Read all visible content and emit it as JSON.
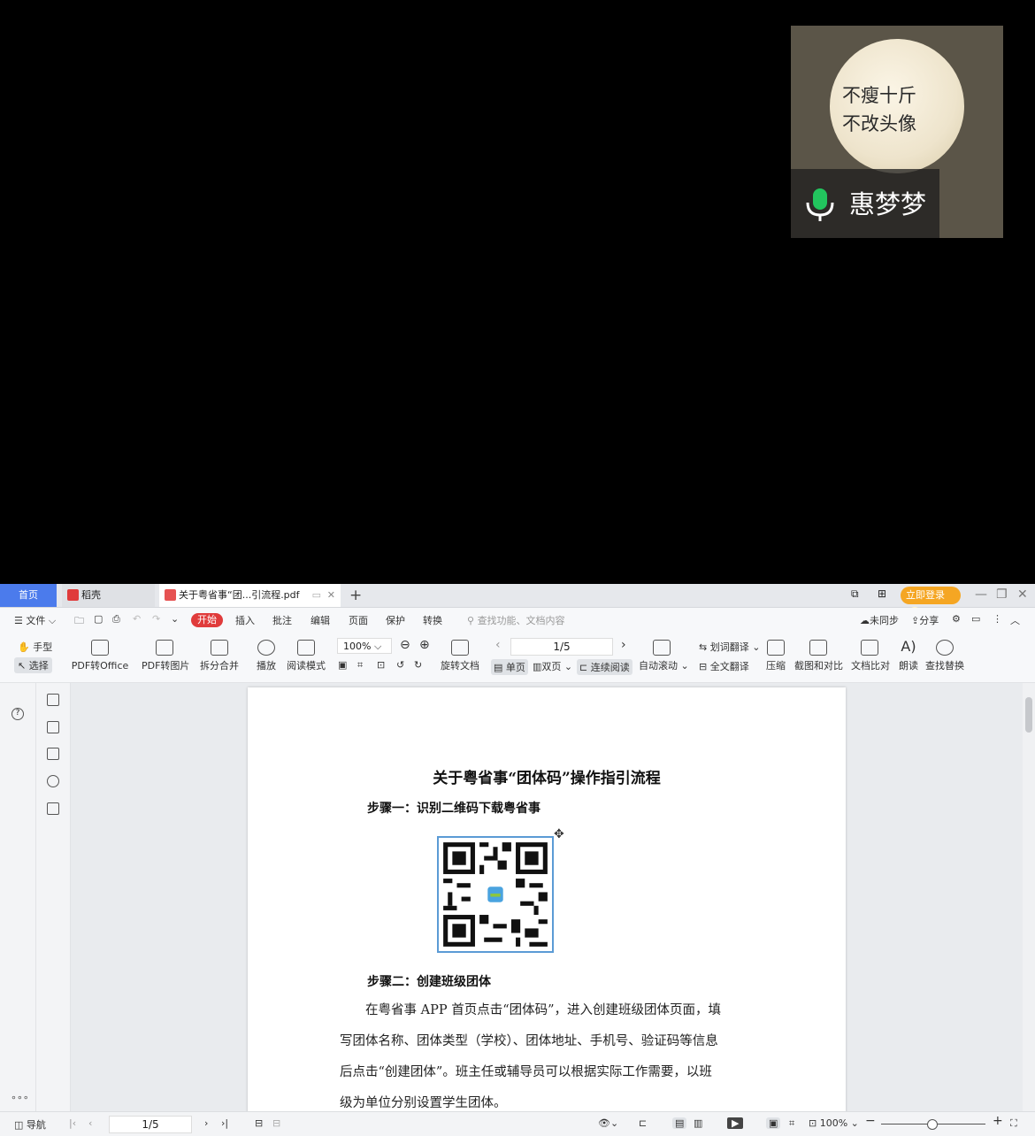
{
  "video": {
    "avatar_text": [
      "不瘦十斤",
      "不改头像"
    ],
    "name": "惠梦梦"
  },
  "tabs": [
    {
      "label": "首页"
    },
    {
      "label": "稻壳"
    },
    {
      "label": "关于粤省事“团...引流程.pdf"
    }
  ],
  "titlebar": {
    "login": "立即登录"
  },
  "menu": {
    "file": "文件",
    "items": [
      "开始",
      "插入",
      "批注",
      "编辑",
      "页面",
      "保护",
      "转换"
    ],
    "search_placeholder": "查找功能、文档内容",
    "unsynced": "未同步",
    "share": "分享"
  },
  "ribbon": {
    "hand": "手型",
    "select": "选择",
    "pdf_to_office": "PDF转Office",
    "pdf_to_image": "PDF转图片",
    "split_merge": "拆分合并",
    "play": "播放",
    "read_mode": "阅读模式",
    "zoom": "100%",
    "page": "1/5",
    "rotate": "旋转文档",
    "single": "单页",
    "double": "双页",
    "continuous": "连续阅读",
    "auto_scroll": "自动滚动",
    "word_translate": "划词翻译",
    "full_translate": "全文翻译",
    "compress": "压缩",
    "screenshot": "截图和对比",
    "compare": "文档比对",
    "read_aloud": "朗读",
    "find_replace": "查找替换"
  },
  "document": {
    "title": "关于粤省事“团体码”操作指引流程",
    "step1": "步骤一：识别二维码下载粤省事",
    "step2": "步骤二：创建班级团体",
    "para_lines": [
      "　　在粤省事 APP 首页点击“团体码”，进入创建班级团体页面，填",
      "写团体名称、团体类型（学校）、团体地址、手机号、验证码等信息",
      "后点击“创建团体”。班主任或辅导员可以根据实际工作需要，以班",
      "级为单位分别设置学生团体。"
    ]
  },
  "statusbar": {
    "nav": "导航",
    "page": "1/5",
    "zoom": "100%"
  },
  "colors": {
    "home_tab": "#4b7bec",
    "start_menu": "#e03b3b",
    "login": "#f5a623",
    "mic": "#22c55e"
  }
}
